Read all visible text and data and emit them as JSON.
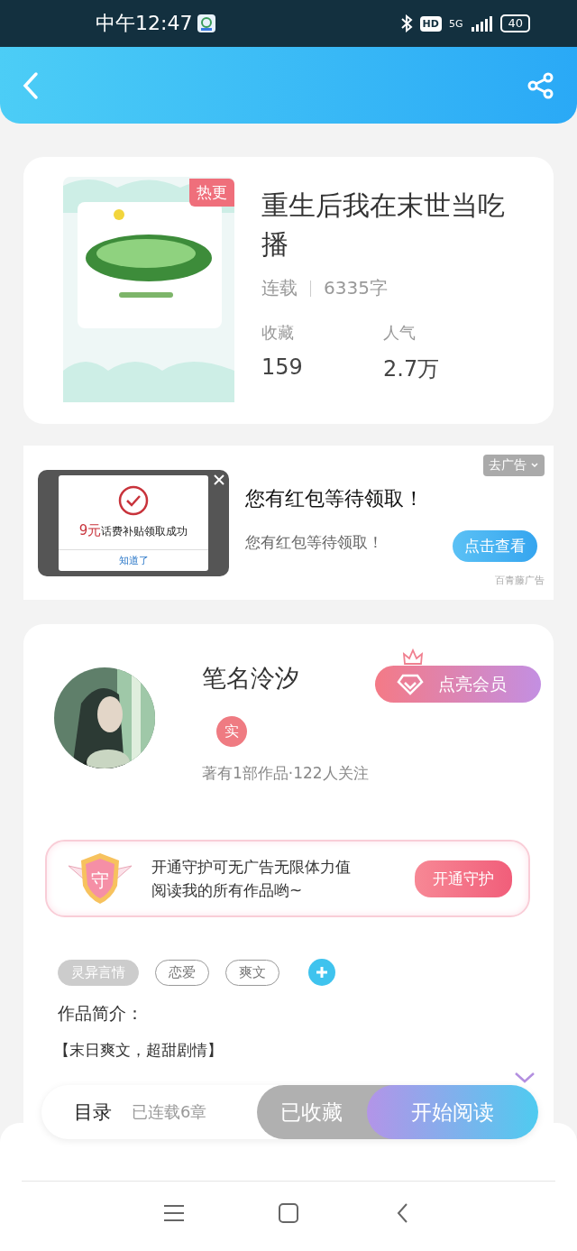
{
  "status_bar": {
    "time": "中午12:47",
    "network": "5G",
    "hd": "HD",
    "battery": "40"
  },
  "book": {
    "badge": "热更",
    "title": "重生后我在末世当吃播",
    "status": "连载",
    "words": "6335字",
    "stats": [
      {
        "label": "收藏",
        "value": "159"
      },
      {
        "label": "人气",
        "value": "2.7万"
      }
    ]
  },
  "ad": {
    "dialog_amount": "9元",
    "dialog_text": "话费补贴领取成功",
    "dialog_button": "知道了",
    "remove": "去广告",
    "title": "您有红包等待领取！",
    "subtitle": "您有红包等待领取！",
    "button": "点击查看",
    "source": "百青藤广告"
  },
  "author": {
    "name": "笔名泠汐",
    "verified_badge": "实",
    "meta": "著有1部作品·122人关注",
    "vip_button": "点亮会员"
  },
  "guard": {
    "icon_text": "守",
    "line1": "开通守护可无广告无限体力值",
    "line2": "阅读我的所有作品哟~",
    "button": "开通守护"
  },
  "tags": [
    {
      "label": "灵异言情",
      "kind": "filled"
    },
    {
      "label": "恋爱",
      "kind": "outline"
    },
    {
      "label": "爽文",
      "kind": "outline"
    }
  ],
  "intro": {
    "heading": "作品简介：",
    "text": "【末日爽文，超甜剧情】"
  },
  "bottom_bar": {
    "catalog": "目录",
    "chapters": "已连载6章",
    "collect": "已收藏",
    "collected": true,
    "read": "开始阅读"
  }
}
